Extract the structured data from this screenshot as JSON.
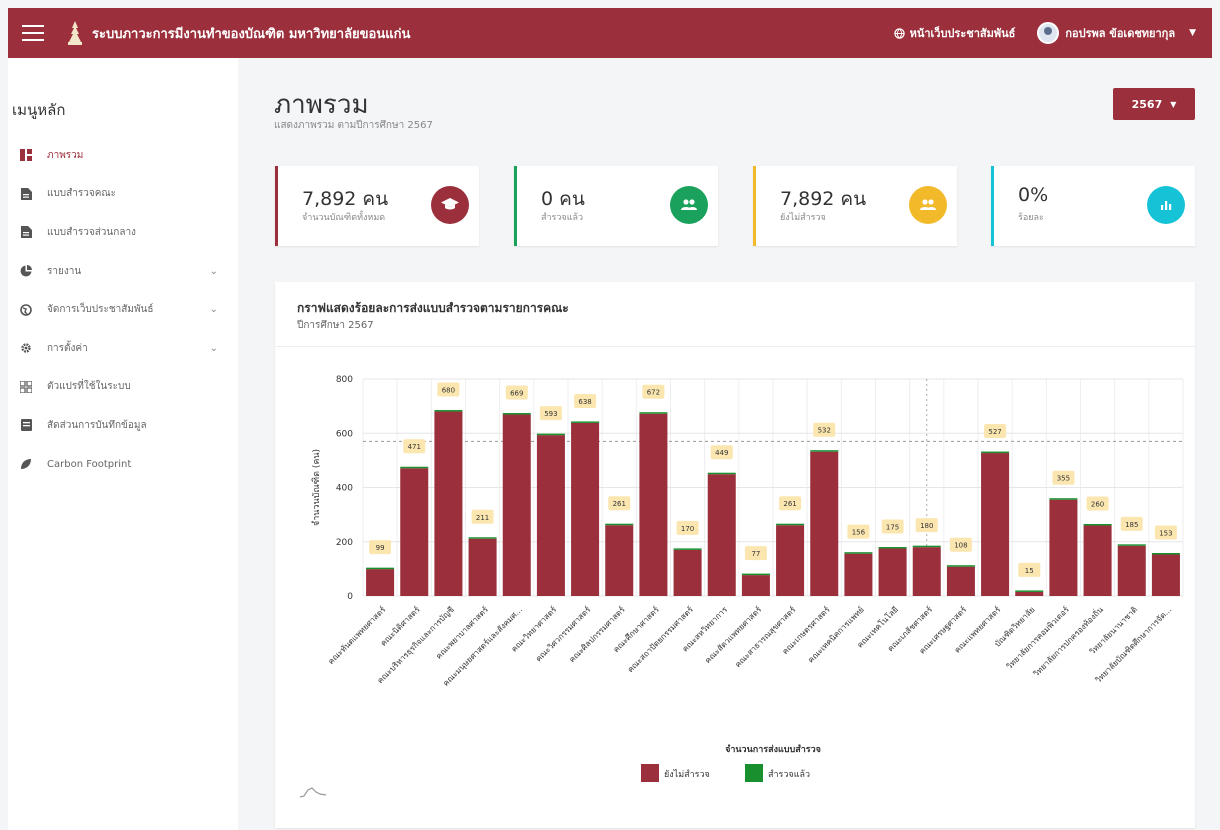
{
  "topbar": {
    "title": "ระบบภาวะการมีงานทำของบัณฑิต มหาวิทยาลัยขอนแก่น",
    "pr_link": "หน้าเว็บประชาสัมพันธ์",
    "user_name": "กอปรพล ข้อเดชทยากุล",
    "brand_color": "#9b2f3b"
  },
  "sidebar": {
    "heading": "เมนูหลัก",
    "items": [
      {
        "label": "ภาพรวม",
        "icon": "dashboard-icon",
        "active": true
      },
      {
        "label": "แบบสำรวจคณะ",
        "icon": "document-icon"
      },
      {
        "label": "แบบสำรวจส่วนกลาง",
        "icon": "document-icon"
      },
      {
        "label": "รายงาน",
        "icon": "pie-chart-icon",
        "expandable": true
      },
      {
        "label": "จัดการเว็บประชาสัมพันธ์",
        "icon": "globe-icon",
        "expandable": true
      },
      {
        "label": "การตั้งค่า",
        "icon": "gear-icon",
        "expandable": true
      },
      {
        "label": "ตัวแปรที่ใช้ในระบบ",
        "icon": "variables-icon"
      },
      {
        "label": "สัดส่วนการบันทึกข้อมูล",
        "icon": "notes-icon"
      },
      {
        "label": "Carbon Footprint",
        "icon": "leaf-icon"
      }
    ]
  },
  "page": {
    "title": "ภาพรวม",
    "subtitle": "แสดงภาพรวม ตามปีการศึกษา 2567",
    "year_selected": "2567"
  },
  "cards": [
    {
      "value": "7,892 คน",
      "label": "จำนวนบัณฑิตทั้งหมด",
      "color": "#9b2f3b",
      "icon": "graduation-cap-icon"
    },
    {
      "value": "0 คน",
      "label": "สำรวจแล้ว",
      "color": "#1aa25c",
      "icon": "users-icon"
    },
    {
      "value": "7,892 คน",
      "label": "ยังไม่สำรวจ",
      "color": "#f2b92b",
      "icon": "users-icon"
    },
    {
      "value": "0%",
      "label": "ร้อยละ",
      "color": "#16c3d6",
      "icon": "bar-chart-icon"
    }
  ],
  "chart_data": {
    "type": "bar",
    "title": "กราฟแสดงร้อยละการส่งแบบสำรวจตามรายการคณะ",
    "subtitle": "ปีการศึกษา 2567",
    "ylabel": "จำนวนบัณฑิต (คน)",
    "xlabel": "จำนวนการส่งแบบสำรวจ",
    "ylim": [
      0,
      800
    ],
    "yticks": [
      0,
      200,
      400,
      600,
      800
    ],
    "average_line": 570,
    "legend_position": "bottom",
    "categories": [
      "คณะทันตแพทยศาสตร์",
      "คณะนิติศาสตร์",
      "คณะบริหารธุรกิจและการบัญชี",
      "คณะพยาบาลศาสตร์",
      "คณะมนุษยศาสตร์และสังคมศ...",
      "คณะวิทยาศาสตร์",
      "คณะวิศวกรรมศาสตร์",
      "คณะศิลปกรรมศาสตร์",
      "คณะศึกษาศาสตร์",
      "คณะสถาปัตยกรรมศาสตร์",
      "คณะสหวิทยาการ",
      "คณะสัตวแพทยศาสตร์",
      "คณะสาธารณสุขศาสตร์",
      "คณะเกษตรศาสตร์",
      "คณะเทคนิคการแพทย์",
      "คณะเทคโนโลยี",
      "คณะเภสัชศาสตร์",
      "คณะเศรษฐศาสตร์",
      "คณะแพทยศาสตร์",
      "บัณฑิตวิทยาลัย",
      "วิทยาลัยการคอมพิวเตอร์",
      "วิทยาลัยการปกครองท้องถิ่น",
      "วิทยาลัยนานาชาติ",
      "วิทยาลัยบัณฑิตศึกษาการจัด..."
    ],
    "series": [
      {
        "name": "ยังไม่สำรวจ",
        "color": "#9b2f3b",
        "values": [
          99,
          471,
          680,
          211,
          669,
          593,
          638,
          261,
          672,
          170,
          449,
          77,
          261,
          532,
          156,
          175,
          180,
          108,
          527,
          15,
          355,
          260,
          185,
          153
        ]
      },
      {
        "name": "สำรวจแล้ว",
        "color": "#1a8f2e",
        "values": [
          0,
          0,
          0,
          0,
          0,
          0,
          0,
          0,
          0,
          0,
          0,
          0,
          0,
          0,
          0,
          0,
          0,
          0,
          0,
          0,
          0,
          0,
          0,
          0
        ]
      }
    ]
  }
}
